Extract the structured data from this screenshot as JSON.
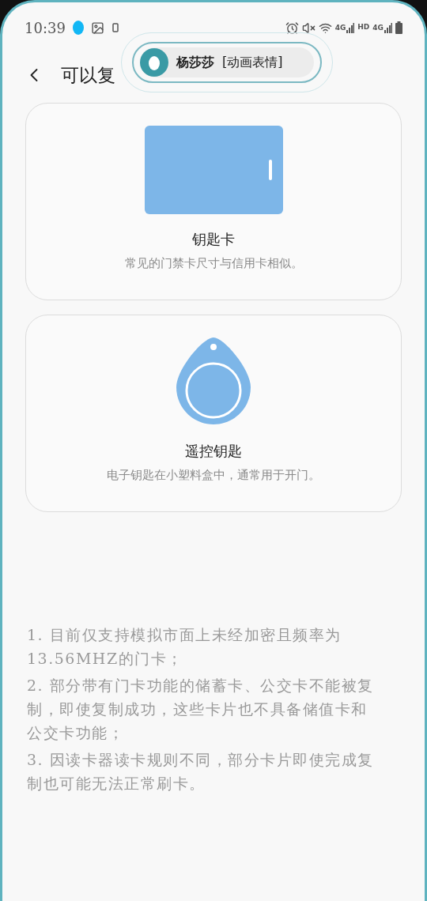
{
  "status_bar": {
    "time": "10:39",
    "network_labels": [
      "4G",
      "HD",
      "4G"
    ]
  },
  "notification": {
    "name": "杨莎莎",
    "message": "[动画表情]"
  },
  "header": {
    "title": "可以复"
  },
  "key_types": [
    {
      "kind": "card",
      "title": "钥匙卡",
      "description": "常见的门禁卡尺寸与信用卡相似。"
    },
    {
      "kind": "fob",
      "title": "遥控钥匙",
      "description": "电子钥匙在小塑料盒中，通常用于开门。"
    }
  ],
  "notes": [
    "1. 目前仅支持模拟市面上未经加密且频率为13.56MHZ的门卡；",
    "2. 部分带有门卡功能的储蓄卡、公交卡不能被复制，即使复制成功，这些卡片也不具备储值卡和公交卡功能；",
    "3. 因读卡器读卡规则不同，部分卡片即使完成复制也可能无法正常刷卡。"
  ]
}
